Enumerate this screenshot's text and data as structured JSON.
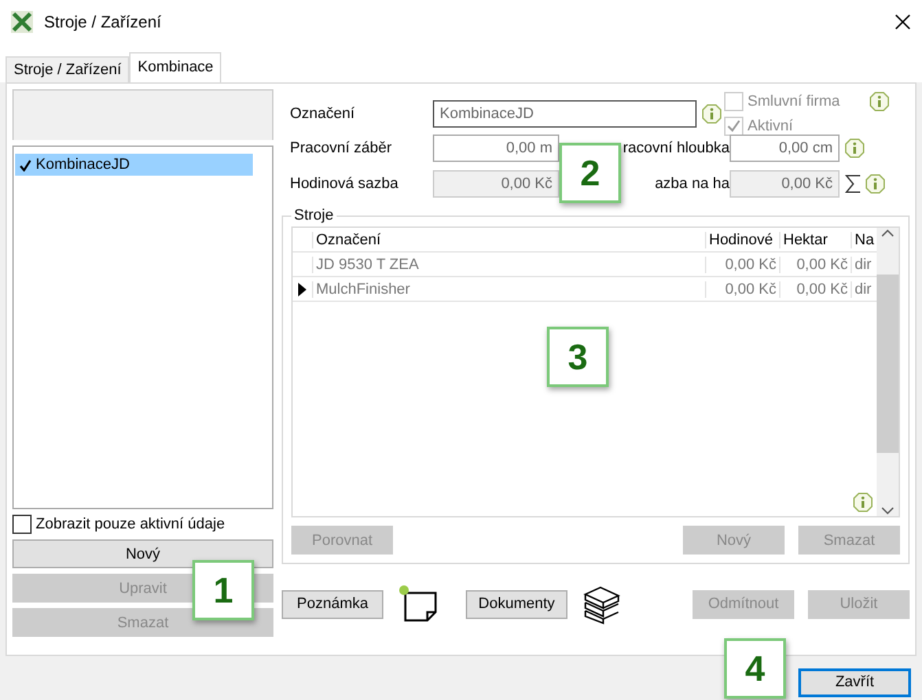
{
  "window": {
    "title": "Stroje / Zařízení"
  },
  "tabs": [
    {
      "label": "Stroje / Zařízení",
      "selected": false
    },
    {
      "label": "Kombinace",
      "selected": true
    }
  ],
  "list": {
    "items": [
      {
        "label": "KombinaceJD",
        "checked": true,
        "selected": true
      }
    ],
    "filter": {
      "label": "Zobrazit pouze aktivní údaje",
      "checked": false
    },
    "buttons": [
      {
        "label": "Nový",
        "disabled": false
      },
      {
        "label": "Upravit",
        "disabled": true
      },
      {
        "label": "Smazat",
        "disabled": true
      }
    ]
  },
  "form": {
    "name": {
      "label": "Označení",
      "value": "KombinaceJD"
    },
    "flags": [
      {
        "label": "Smluvní firma",
        "checked": false
      },
      {
        "label": "Aktivní",
        "checked": true
      }
    ],
    "rows": [
      {
        "label": "Pracovní záběr",
        "value": "0,00 m",
        "label2": "racovní hloubka",
        "value2": "0,00 cm",
        "sum": false
      },
      {
        "label": "Hodinová sazba",
        "value": "0,00 Kč",
        "label2": "azba na ha",
        "value2": "0,00 Kč",
        "sum": true
      }
    ]
  },
  "machines": {
    "title": "Stroje",
    "columns": [
      "Označení",
      "Hodinové",
      "Hektar",
      "Na"
    ],
    "rows": [
      {
        "cells": [
          "JD 9530 T ZEA",
          "0,00 Kč",
          "0,00 Kč",
          "dir"
        ],
        "current": false
      },
      {
        "cells": [
          "MulchFinisher",
          "0,00 Kč",
          "0,00 Kč",
          "dir"
        ],
        "current": true
      }
    ],
    "buttons": [
      {
        "label": "Porovnat",
        "disabled": true
      },
      {
        "label": "Nový",
        "disabled": true
      },
      {
        "label": "Smazat",
        "disabled": true
      }
    ]
  },
  "actions": [
    {
      "label": "Poznámka",
      "disabled": false
    },
    {
      "label": "Dokumenty",
      "disabled": false
    },
    {
      "label": "Odmítnout",
      "disabled": true
    },
    {
      "label": "Uložit",
      "disabled": true
    }
  ],
  "close_button": {
    "label": "Zavřít"
  },
  "callouts": [
    {
      "label": "1"
    },
    {
      "label": "2"
    },
    {
      "label": "3"
    },
    {
      "label": "4"
    }
  ]
}
